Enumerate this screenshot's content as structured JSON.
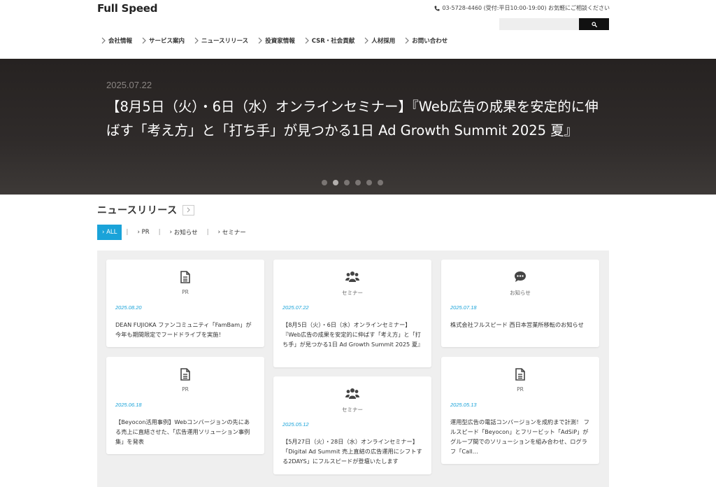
{
  "header": {
    "logo": "Full Speed",
    "contact": "03-5728-4460 (受付:平日10:00-19:00) お気軽にご相談ください",
    "search_placeholder": "",
    "nav": [
      {
        "label": "会社情報"
      },
      {
        "label": "サービス案内"
      },
      {
        "label": "ニュースリリース"
      },
      {
        "label": "投資家情報"
      },
      {
        "label": "CSR・社会貢献"
      },
      {
        "label": "人材採用"
      },
      {
        "label": "お問い合わせ"
      }
    ]
  },
  "hero": {
    "date": "2025.07.22",
    "title": "【8月5日（火）・6日（水）オンラインセミナー】『Web広告の成果を安定的に伸ばす「考え方」と「打ち手」が見つかる1日 Ad Growth Summit 2025 夏』",
    "dot_count": 6,
    "active_dot": 2
  },
  "news": {
    "title": "ニュースリリース",
    "filters": [
      {
        "label": "ALL",
        "active": true
      },
      {
        "label": "PR",
        "active": false
      },
      {
        "label": "お知らせ",
        "active": false
      },
      {
        "label": "セミナー",
        "active": false
      }
    ],
    "cards": [
      {
        "icon": "document-icon",
        "category": "PR",
        "date": "2025.08.20",
        "text": "DEAN FUJIOKA ファンコミュニティ「FamBam」が今年も期間限定でフードドライブを実施！"
      },
      {
        "icon": "group-icon",
        "category": "セミナー",
        "date": "2025.07.22",
        "text": "【8月5日（火）・6日（水）オンラインセミナー】『Web広告の成果を安定的に伸ばす「考え方」と「打ち手」が見つかる1日 Ad Growth Summit 2025 夏』"
      },
      {
        "icon": "chat-icon",
        "category": "お知らせ",
        "date": "2025.07.18",
        "text": "株式会社フルスピード 西日本営業所移転のお知らせ"
      },
      {
        "icon": "document-icon",
        "category": "PR",
        "date": "2025.06.18",
        "text": "【Beyocon活用事例】Webコンバージョンの先にある売上に直結させた、「広告運用ソリューション事例集」を発表"
      },
      {
        "icon": "group-icon",
        "category": "セミナー",
        "date": "2025.05.12",
        "text": "【5月27日（火）・28日（水）オンラインセミナー】「Digital Ad Summit 売上直結の広告運用にシフトする2DAYS」にフルスピードが登壇いたします"
      },
      {
        "icon": "document-icon",
        "category": "PR",
        "date": "2025.05.13",
        "text": "運用型広告の電話コンバージョンを成約まで計測！ フルスピード「Beyocon」とフリービット「AdSiP」がグループ間でのソリューションを組み合わせ、ログラフ「Call…"
      }
    ]
  },
  "colors": {
    "accent": "#1aa3d9",
    "hero_bg": "#2f2b2a",
    "search_button": "#111111"
  }
}
